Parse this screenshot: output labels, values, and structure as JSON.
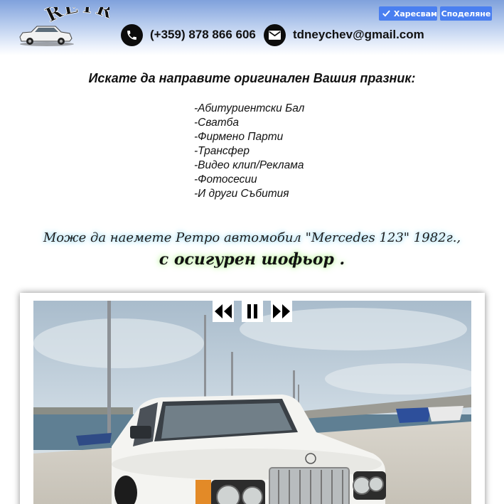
{
  "header": {
    "logo_text": "RETRO",
    "phone": "(+359) 878 866 606",
    "email": "tdneychev@gmail.com",
    "phone_icon": "phone-icon",
    "email_icon": "envelope-icon",
    "like_label": "Харесвам",
    "share_label": "Споделяне",
    "like_color": "#4a7ff0"
  },
  "intro": {
    "headline": "Искате да направите оригинален Вашия празник:",
    "services": [
      "-Абитуриентски Бал",
      "-Сватба",
      "-Фирмено Парти",
      "-Трансфер",
      "-Видео клип/Реклама",
      "-Фотосесии",
      "-И други Събития"
    ]
  },
  "tagline": {
    "line1": "Може да наемете Ретро автомобил \"Mercedes 123\" 1982г.,",
    "line2": "с осигурен шофьор ."
  },
  "slider": {
    "prev_icon": "rewind-icon",
    "pause_icon": "pause-icon",
    "next_icon": "fast-forward-icon"
  }
}
